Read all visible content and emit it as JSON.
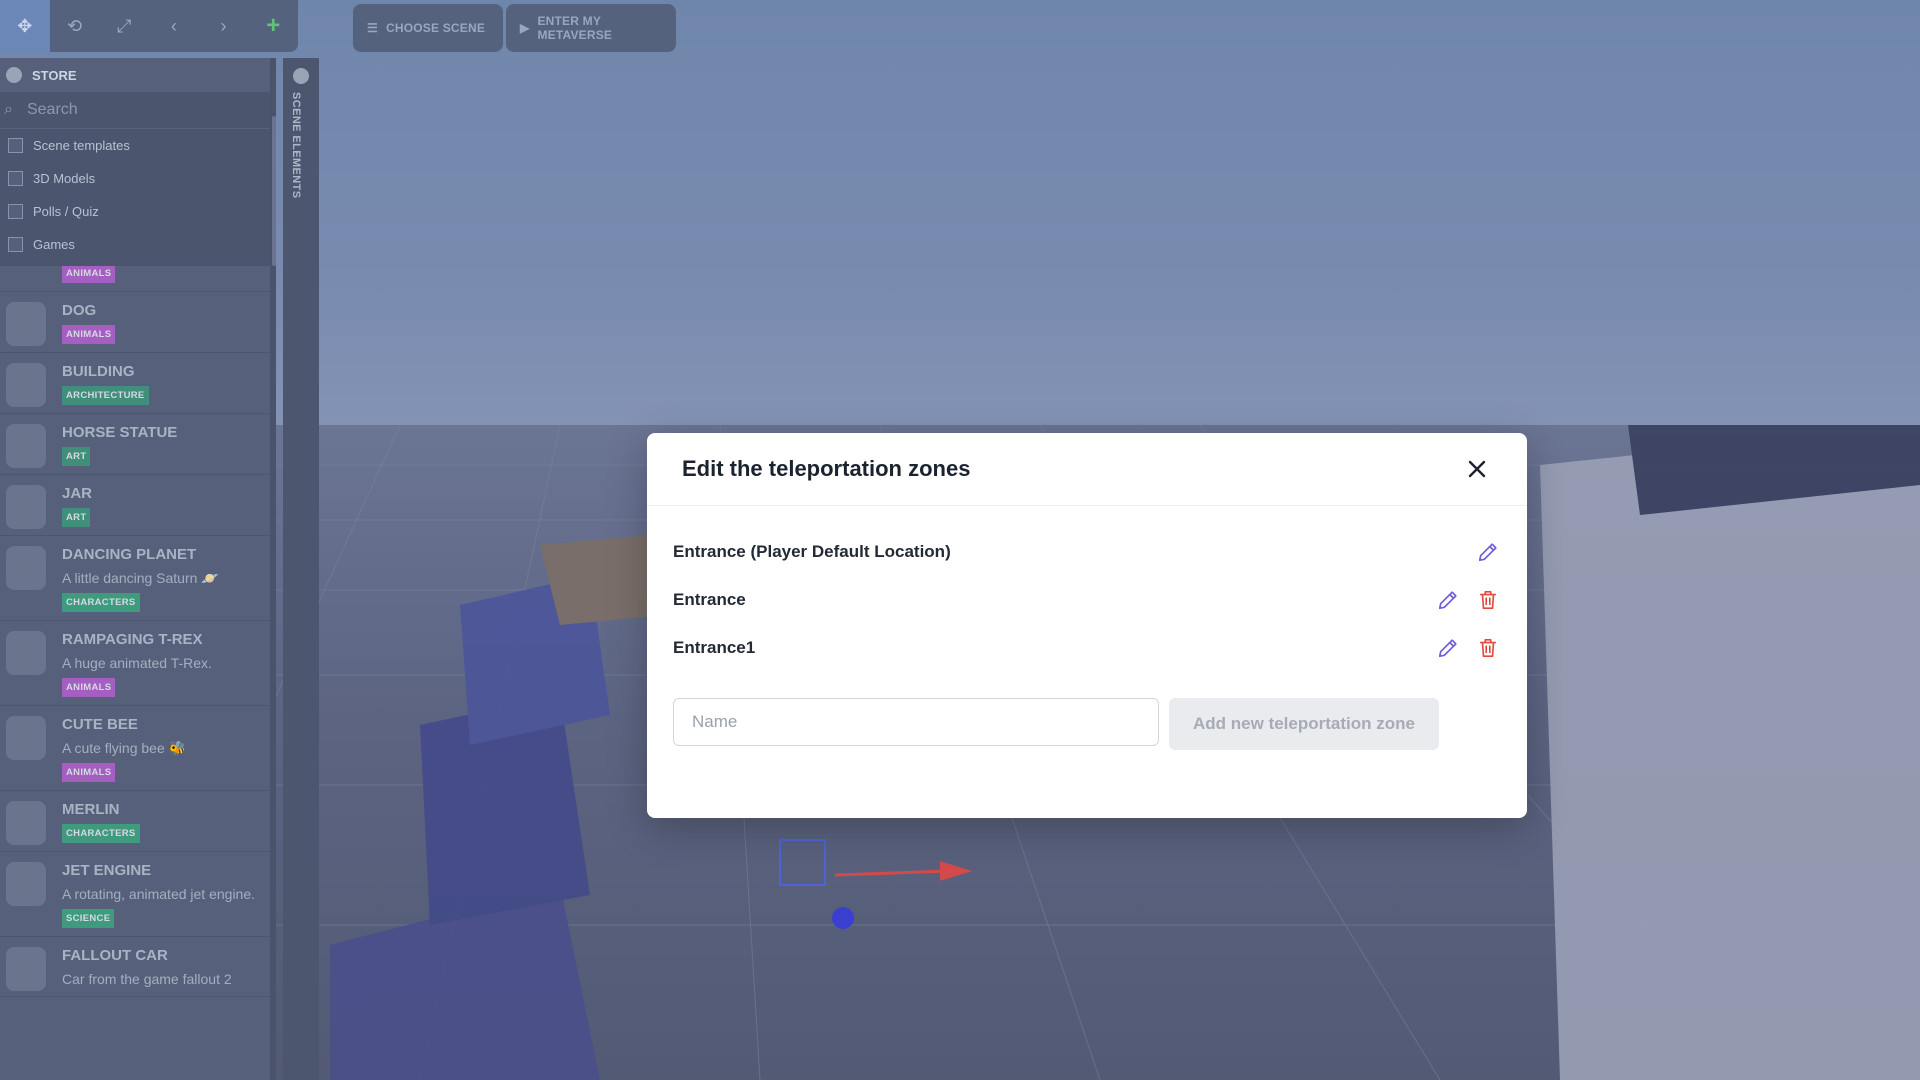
{
  "toolbar": {
    "tools": [
      {
        "icon": "move-icon",
        "glyph": "✥"
      },
      {
        "icon": "rotate-icon",
        "glyph": "⟲"
      },
      {
        "icon": "scale-icon",
        "glyph": "⤢"
      },
      {
        "icon": "undo-icon",
        "glyph": "‹"
      },
      {
        "icon": "redo-icon",
        "glyph": "›"
      },
      {
        "icon": "add-icon",
        "glyph": "+"
      }
    ],
    "choose_scene": "CHOOSE SCENE",
    "enter_metaverse": "ENTER MY METAVERSE"
  },
  "store": {
    "title": "STORE",
    "search_placeholder": "Search",
    "filters": [
      "Scene templates",
      "3D Models",
      "Polls / Quiz",
      "Games"
    ],
    "items": [
      {
        "title": "",
        "desc": "",
        "tag": "ANIMALS",
        "tag_color": "#a45fc0"
      },
      {
        "title": "DOG",
        "desc": "",
        "tag": "ANIMALS",
        "tag_color": "#a45fc0"
      },
      {
        "title": "BUILDING",
        "desc": "",
        "tag": "ARCHITECTURE",
        "tag_color": "#3f8f7a"
      },
      {
        "title": "HORSE STATUE",
        "desc": "",
        "tag": "ART",
        "tag_color": "#3f8f7a"
      },
      {
        "title": "JAR",
        "desc": "",
        "tag": "ART",
        "tag_color": "#3f8f7a"
      },
      {
        "title": "DANCING PLANET",
        "desc": "A little dancing Saturn 🪐",
        "tag": "CHARACTERS",
        "tag_color": "#3f9a7e"
      },
      {
        "title": "RAMPAGING T-REX",
        "desc": "A huge animated T-Rex.",
        "tag": "ANIMALS",
        "tag_color": "#a45fc0"
      },
      {
        "title": "CUTE BEE",
        "desc": "A cute flying bee 🐝",
        "tag": "ANIMALS",
        "tag_color": "#a45fc0"
      },
      {
        "title": "MERLIN",
        "desc": "",
        "tag": "CHARACTERS",
        "tag_color": "#3f9a7e"
      },
      {
        "title": "JET ENGINE",
        "desc": "A rotating, animated jet engine.",
        "tag": "SCIENCE",
        "tag_color": "#3f9a7e"
      },
      {
        "title": "FALLOUT CAR",
        "desc": "Car from the game fallout 2",
        "tag": "",
        "tag_color": "#3f9a7e"
      }
    ]
  },
  "scene_elements": {
    "label": "SCENE ELEMENTS"
  },
  "modal": {
    "title": "Edit the teleportation zones",
    "zones": [
      {
        "name": "Entrance (Player Default Location)",
        "deletable": false
      },
      {
        "name": "Entrance",
        "deletable": true
      },
      {
        "name": "Entrance1",
        "deletable": true
      }
    ],
    "name_placeholder": "Name",
    "name_value": "",
    "add_button": "Add new teleportation zone",
    "colors": {
      "edit": "#6b5bd6",
      "delete": "#e0493e"
    }
  }
}
